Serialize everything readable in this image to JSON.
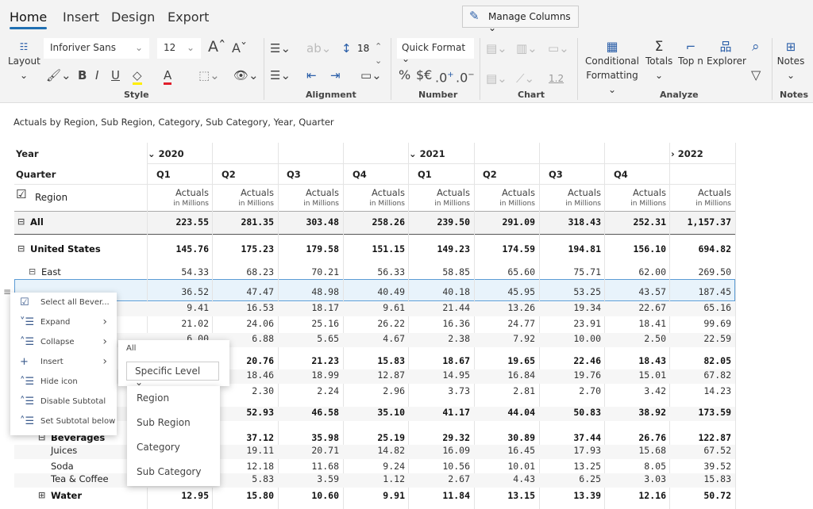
{
  "tabs": [
    {
      "label": "Home",
      "active": true
    },
    {
      "label": "Insert"
    },
    {
      "label": "Design"
    },
    {
      "label": "Export"
    }
  ],
  "manage_columns": "Manage Columns",
  "ribbon": {
    "layout": "Layout",
    "font": "Inforiver Sans",
    "font_size": "12",
    "line_height": "18",
    "quick_format": "Quick Format",
    "decimal_sample": "1.2",
    "conditional": "Conditional",
    "formatting": "Formatting",
    "totals": "Totals",
    "topn": "Top n",
    "explorer": "Explorer",
    "notes": "Notes",
    "groups": {
      "style": "Style",
      "alignment": "Alignment",
      "number": "Number",
      "chart": "Chart",
      "analyze": "Analyze",
      "notes": "Notes"
    },
    "colors": {
      "highlight": "#ffee00",
      "font_color": "#e01e2b",
      "accent": "#1f6fb2"
    }
  },
  "subtitle": "Actuals by Region, Sub Region, Category, Sub Category, Year, Quarter",
  "grid": {
    "year_label": "Year",
    "quarter_label": "Quarter",
    "region_label": "Region",
    "years": [
      {
        "label": "2020",
        "state": "expanded"
      },
      {
        "label": "2021",
        "state": "expanded"
      },
      {
        "label": "2022",
        "state": "collapsed"
      }
    ],
    "quarters": [
      "Q1",
      "Q2",
      "Q3",
      "Q4",
      "Q1",
      "Q2",
      "Q3",
      "Q4",
      ""
    ],
    "measure": "Actuals",
    "unit": "in Millions",
    "rows": [
      {
        "label": "All",
        "bold": true,
        "toggle": "minus",
        "values": [
          "223.55",
          "281.35",
          "303.48",
          "258.26",
          "239.50",
          "291.09",
          "318.43",
          "252.31",
          "1,157.37"
        ]
      },
      {
        "label": "United States",
        "bold": true,
        "toggle": "minus",
        "values": [
          "145.76",
          "175.23",
          "179.58",
          "151.15",
          "149.23",
          "174.59",
          "194.81",
          "156.10",
          "694.82"
        ]
      },
      {
        "label": "East",
        "toggle": "minus",
        "values": [
          "54.33",
          "68.23",
          "70.21",
          "56.33",
          "58.85",
          "65.60",
          "75.71",
          "62.00",
          "269.50"
        ]
      },
      {
        "label": "",
        "selected": true,
        "values": [
          "36.52",
          "47.47",
          "48.98",
          "40.49",
          "40.18",
          "45.95",
          "53.25",
          "43.57",
          "187.45"
        ]
      },
      {
        "label": "",
        "values": [
          "9.41",
          "16.53",
          "18.17",
          "9.61",
          "21.44",
          "13.26",
          "19.34",
          "22.67",
          "65.16"
        ]
      },
      {
        "label": "",
        "values": [
          "21.02",
          "24.06",
          "25.16",
          "26.22",
          "16.36",
          "24.77",
          "23.91",
          "18.41",
          "99.69"
        ]
      },
      {
        "label": "",
        "values": [
          "6.00",
          "6.88",
          "5.65",
          "4.67",
          "2.38",
          "7.92",
          "10.00",
          "2.50",
          "22.59"
        ]
      },
      {
        "label": "",
        "bold": true,
        "values": [
          "",
          "20.76",
          "21.23",
          "15.83",
          "18.67",
          "19.65",
          "22.46",
          "18.43",
          "82.05"
        ]
      },
      {
        "label": "",
        "values": [
          "",
          "18.46",
          "18.99",
          "12.87",
          "14.95",
          "16.84",
          "19.76",
          "15.01",
          "67.82"
        ]
      },
      {
        "label": "",
        "values": [
          "",
          "2.30",
          "2.24",
          "2.96",
          "3.73",
          "2.81",
          "2.70",
          "3.42",
          "14.23"
        ]
      },
      {
        "label": "",
        "bold": true,
        "values": [
          "",
          "52.93",
          "46.58",
          "35.10",
          "41.17",
          "44.04",
          "50.83",
          "38.92",
          "173.59"
        ]
      },
      {
        "label": "Beverages",
        "bold": true,
        "toggle": "minus",
        "values": [
          "",
          "37.12",
          "35.98",
          "25.19",
          "29.32",
          "30.89",
          "37.44",
          "26.76",
          "122.87"
        ]
      },
      {
        "label": "Juices",
        "values": [
          "",
          "19.11",
          "20.71",
          "14.82",
          "16.09",
          "16.45",
          "17.93",
          "15.68",
          "67.52"
        ]
      },
      {
        "label": "Soda",
        "values": [
          "",
          "12.18",
          "11.68",
          "9.24",
          "10.56",
          "10.01",
          "13.25",
          "8.05",
          "39.52"
        ]
      },
      {
        "label": "Tea & Coffee",
        "values": [
          "",
          "5.83",
          "3.59",
          "1.12",
          "2.67",
          "4.43",
          "6.25",
          "3.03",
          "15.83"
        ]
      },
      {
        "label": "Water",
        "bold": true,
        "toggle": "plus",
        "values": [
          "12.95",
          "15.80",
          "10.60",
          "9.91",
          "11.84",
          "13.15",
          "13.39",
          "12.16",
          "50.72"
        ]
      }
    ]
  },
  "context_menu": {
    "items": [
      {
        "label": "Select all Bever...",
        "icon": "select-all-icon"
      },
      {
        "label": "Expand",
        "icon": "expand-icon",
        "submenu": true
      },
      {
        "label": "Collapse",
        "icon": "collapse-icon",
        "submenu": true
      },
      {
        "label": "Insert",
        "icon": "plus-icon",
        "submenu": true
      },
      {
        "label": "Hide icon",
        "icon": "hide-icon"
      },
      {
        "label": "Disable Subtotal",
        "icon": "subtotal-icon"
      },
      {
        "label": "Set Subtotal below",
        "icon": "subtotal-below-icon"
      }
    ]
  },
  "collapse_submenu": {
    "all": "All",
    "specific_level": "Specific Level",
    "levels": [
      "Region",
      "Sub Region",
      "Category",
      "Sub Category"
    ]
  }
}
